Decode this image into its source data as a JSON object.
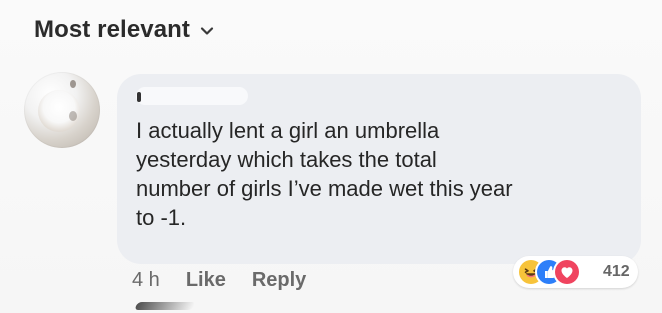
{
  "header": {
    "sort_label": "Most relevant"
  },
  "comment": {
    "text": "I actually lent a girl an umbrella\nyesterday which takes the total\nnumber of girls I’ve made wet this year\nto -1.",
    "time": "4 h",
    "like_label": "Like",
    "reply_label": "Reply",
    "reaction_count": "412"
  },
  "icons": {
    "sort_chevron": "chevron-down-icon",
    "avatar": "avatar-image",
    "haha": "haha-reaction-icon",
    "like": "like-reaction-icon",
    "love": "love-reaction-icon"
  },
  "colors": {
    "bubble": "#eceef2",
    "haha": "#f7c33a",
    "like": "#2d7ff9",
    "love": "#f0445f"
  }
}
